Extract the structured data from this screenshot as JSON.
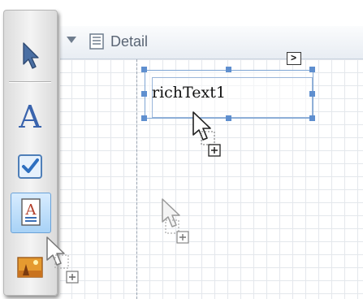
{
  "band": {
    "title": "Detail"
  },
  "control": {
    "text": "richText1"
  },
  "smart_tag": {
    "glyph": ">"
  },
  "toolbox": {
    "tools": [
      "pointer-icon",
      "label-icon",
      "checkbox-icon",
      "richtext-icon",
      "picturebox-icon"
    ],
    "selected": "richtext-icon"
  },
  "colors": {
    "selection": "#5f8fcf",
    "grid": "#e4e7ec",
    "band_text": "#5a6574"
  }
}
